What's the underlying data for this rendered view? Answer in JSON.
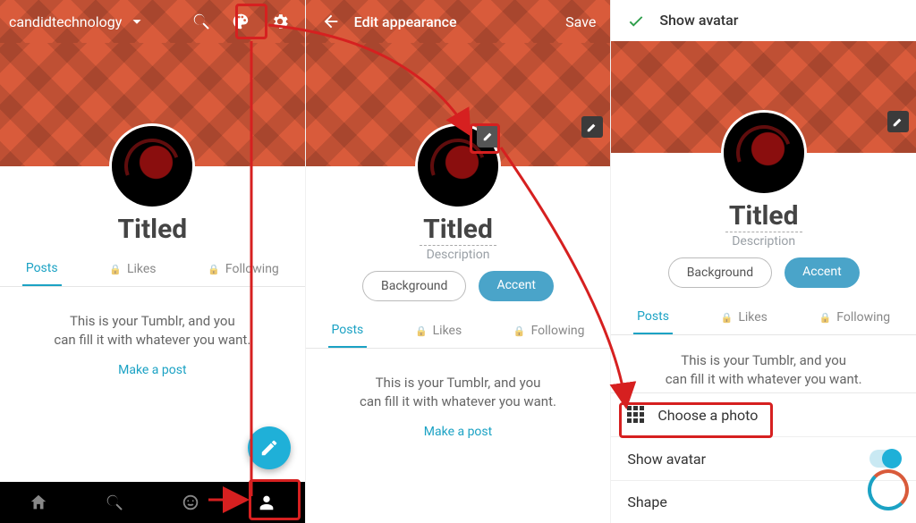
{
  "pane1": {
    "blog_name": "candidtechnology",
    "title": "Titled",
    "tabs": {
      "posts": "Posts",
      "likes": "Likes",
      "following": "Following"
    },
    "empty_line1": "This is your Tumblr, and you",
    "empty_line2": "can fill it with whatever you want.",
    "make_post": "Make a post"
  },
  "pane2": {
    "header_title": "Edit appearance",
    "save": "Save",
    "title": "Titled",
    "description": "Description",
    "pill_background": "Background",
    "pill_accent": "Accent",
    "tabs": {
      "posts": "Posts",
      "likes": "Likes",
      "following": "Following"
    },
    "empty_line1": "This is your Tumblr, and you",
    "empty_line2": "can fill it with whatever you want.",
    "make_post": "Make a post"
  },
  "pane3": {
    "header_title": "Show avatar",
    "title": "Titled",
    "description": "Description",
    "pill_background": "Background",
    "pill_accent": "Accent",
    "tabs": {
      "posts": "Posts",
      "likes": "Likes",
      "following": "Following"
    },
    "empty_line1": "This is your Tumblr, and you",
    "empty_line2": "can fill it with whatever you want.",
    "sheet": {
      "choose_photo": "Choose a photo",
      "show_avatar": "Show avatar",
      "shape": "Shape"
    }
  },
  "colors": {
    "accent": "#1ba2c4",
    "brand": "#d95b3b"
  }
}
